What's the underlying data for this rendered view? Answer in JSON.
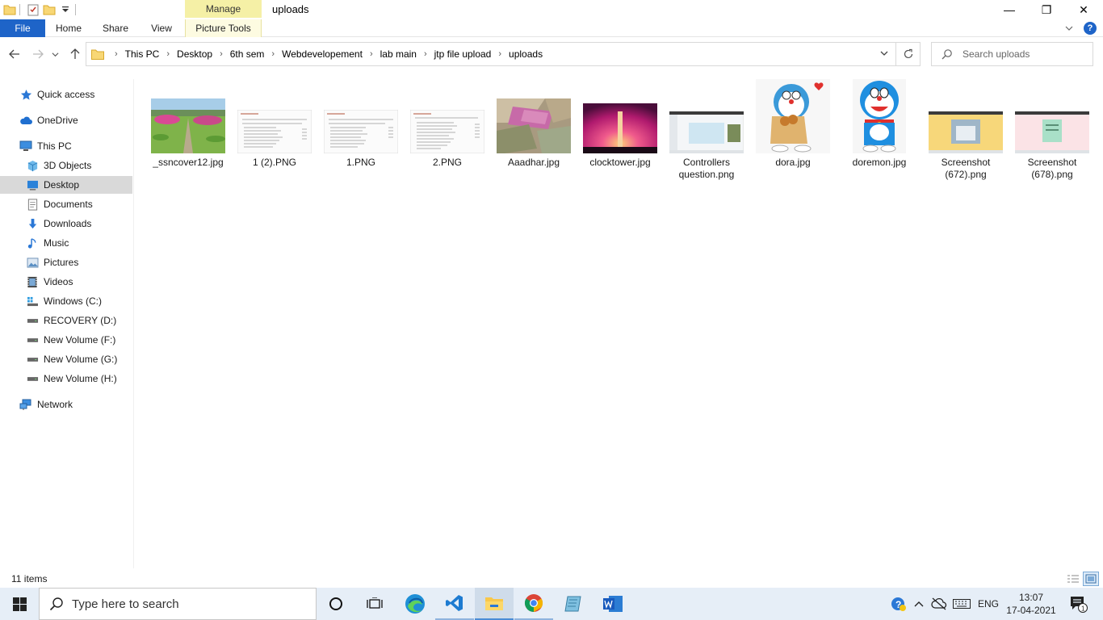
{
  "window": {
    "title": "uploads",
    "contextual_tab": "Manage",
    "minimize": "—",
    "maximize": "❐",
    "close": "✕"
  },
  "ribbon": {
    "tabs": [
      "File",
      "Home",
      "Share",
      "View",
      "Picture Tools"
    ],
    "expand_icon": "chevron-down-icon",
    "help": "?"
  },
  "address": {
    "breadcrumbs": [
      "This PC",
      "Desktop",
      "6th sem",
      "Webdevelopement",
      "lab main",
      "jtp file upload",
      "uploads"
    ]
  },
  "search": {
    "placeholder": "Search uploads",
    "value": ""
  },
  "nav": {
    "items": [
      {
        "label": "Quick access",
        "icon": "star-icon"
      },
      {
        "label": "OneDrive",
        "icon": "cloud-icon"
      },
      {
        "label": "This PC",
        "icon": "computer-icon"
      },
      {
        "label": "3D Objects",
        "icon": "cube-icon"
      },
      {
        "label": "Desktop",
        "icon": "desktop-icon",
        "selected": true
      },
      {
        "label": "Documents",
        "icon": "document-icon"
      },
      {
        "label": "Downloads",
        "icon": "download-icon"
      },
      {
        "label": "Music",
        "icon": "music-icon"
      },
      {
        "label": "Pictures",
        "icon": "pictures-icon"
      },
      {
        "label": "Videos",
        "icon": "videos-icon"
      },
      {
        "label": "Windows (C:)",
        "icon": "windows-drive-icon"
      },
      {
        "label": "RECOVERY (D:)",
        "icon": "drive-icon"
      },
      {
        "label": "New Volume (F:)",
        "icon": "drive-icon"
      },
      {
        "label": "New Volume (G:)",
        "icon": "drive-icon"
      },
      {
        "label": "New Volume (H:)",
        "icon": "drive-icon"
      },
      {
        "label": "Network",
        "icon": "network-icon"
      }
    ]
  },
  "files": [
    {
      "name": "_ssncover12.jpg",
      "kind": "campus-photo"
    },
    {
      "name": "1 (2).PNG",
      "kind": "document"
    },
    {
      "name": "1.PNG",
      "kind": "document"
    },
    {
      "name": "2.PNG",
      "kind": "document"
    },
    {
      "name": "Aaadhar.jpg",
      "kind": "money-photo"
    },
    {
      "name": "clocktower.jpg",
      "kind": "tower-photo"
    },
    {
      "name": "Controllers question.png",
      "kind": "screenshot-blue"
    },
    {
      "name": "dora.jpg",
      "kind": "cartoon"
    },
    {
      "name": "doremon.jpg",
      "kind": "cartoon"
    },
    {
      "name": "Screenshot (672).png",
      "kind": "screenshot-yellow"
    },
    {
      "name": "Screenshot (678).png",
      "kind": "screenshot-pink"
    }
  ],
  "status": {
    "count": "11 items"
  },
  "taskbar": {
    "search_placeholder": "Type here to search",
    "language": "ENG",
    "time": "13:07",
    "date": "17-04-2021",
    "notification_count": "1"
  }
}
